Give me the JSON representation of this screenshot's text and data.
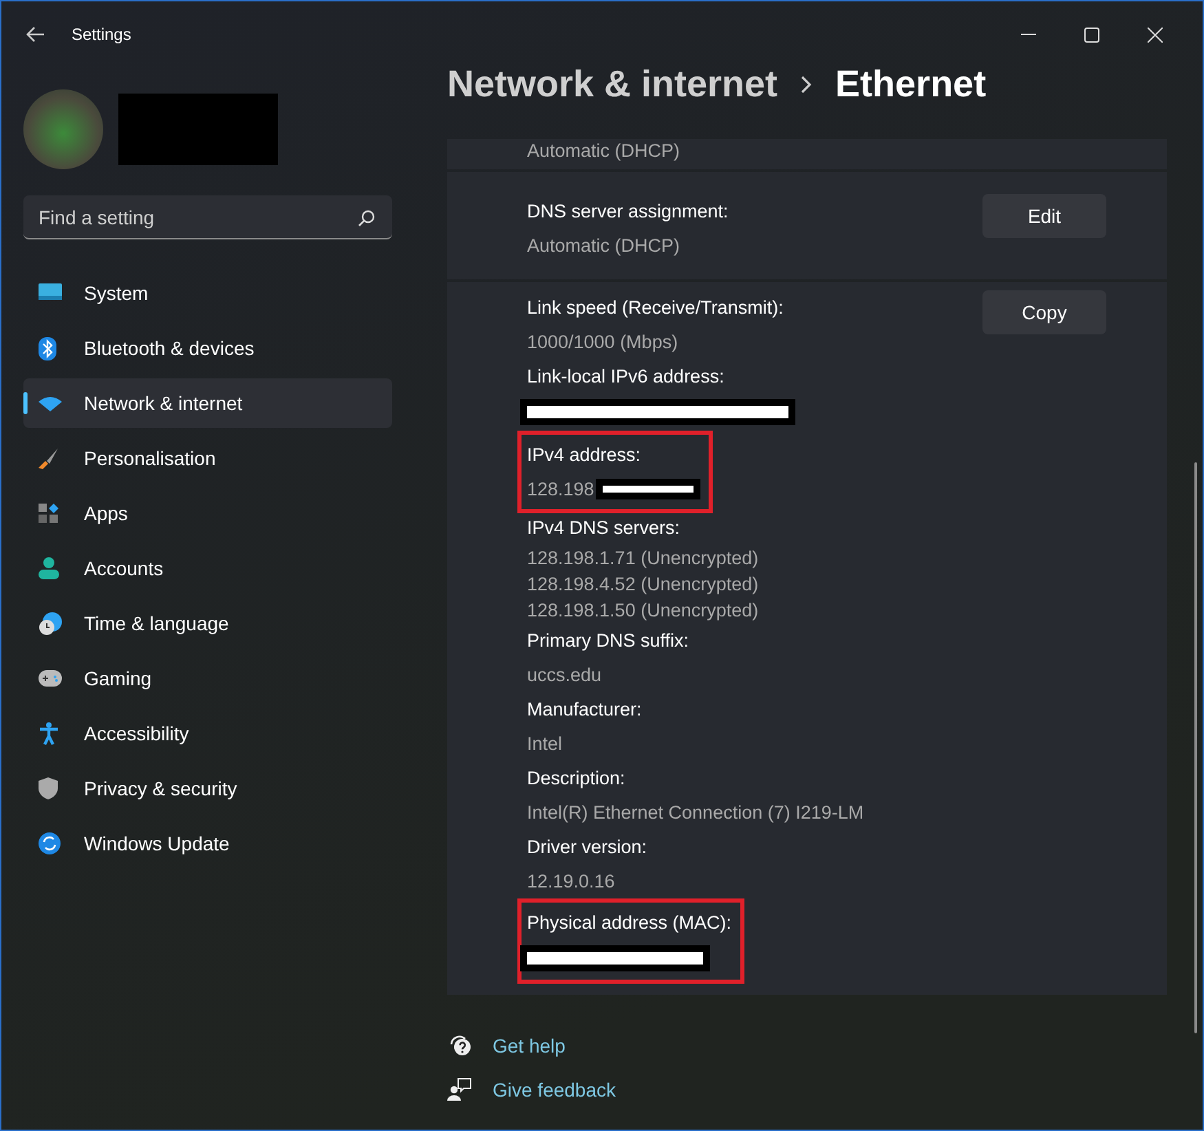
{
  "window": {
    "title": "Settings"
  },
  "profile": {
    "name_hidden": true
  },
  "search": {
    "placeholder": "Find a setting"
  },
  "nav": [
    {
      "label": "System",
      "selected": false
    },
    {
      "label": "Bluetooth & devices",
      "selected": false
    },
    {
      "label": "Network & internet",
      "selected": true
    },
    {
      "label": "Personalisation",
      "selected": false
    },
    {
      "label": "Apps",
      "selected": false
    },
    {
      "label": "Accounts",
      "selected": false
    },
    {
      "label": "Time & language",
      "selected": false
    },
    {
      "label": "Gaming",
      "selected": false
    },
    {
      "label": "Accessibility",
      "selected": false
    },
    {
      "label": "Privacy & security",
      "selected": false
    },
    {
      "label": "Windows Update",
      "selected": false
    }
  ],
  "breadcrumb": {
    "parent": "Network & internet",
    "current": "Ethernet"
  },
  "groups": [
    {
      "rows": [
        {
          "values": [
            "Automatic (DHCP)"
          ]
        }
      ]
    },
    {
      "button": "Edit",
      "rows": [
        {
          "label": "DNS server assignment:",
          "values": [
            "Automatic (DHCP)"
          ]
        }
      ]
    },
    {
      "button": "Copy",
      "rows": [
        {
          "label": "Link speed (Receive/Transmit):",
          "values": [
            "1000/1000 (Mbps)"
          ]
        },
        {
          "label": "Link-local IPv6 address:",
          "values": [],
          "redacted": true
        },
        {
          "label": "IPv4 address:",
          "values": [
            "128.198"
          ],
          "redacted": true,
          "highlighted": true
        },
        {
          "label": "IPv4 DNS servers:",
          "values": [
            "128.198.1.71 (Unencrypted)",
            "128.198.4.52 (Unencrypted)",
            "128.198.1.50 (Unencrypted)"
          ]
        },
        {
          "label": "Primary DNS suffix:",
          "values": [
            "uccs.edu"
          ]
        },
        {
          "label": "Manufacturer:",
          "values": [
            "Intel"
          ]
        },
        {
          "label": "Description:",
          "values": [
            "Intel(R) Ethernet Connection (7) I219-LM"
          ]
        },
        {
          "label": "Driver version:",
          "values": [
            "12.19.0.16"
          ]
        },
        {
          "label": "Physical address (MAC):",
          "values": [],
          "redacted": true,
          "highlighted": true
        }
      ]
    }
  ],
  "links": [
    {
      "label": "Get help"
    },
    {
      "label": "Give feedback"
    }
  ]
}
